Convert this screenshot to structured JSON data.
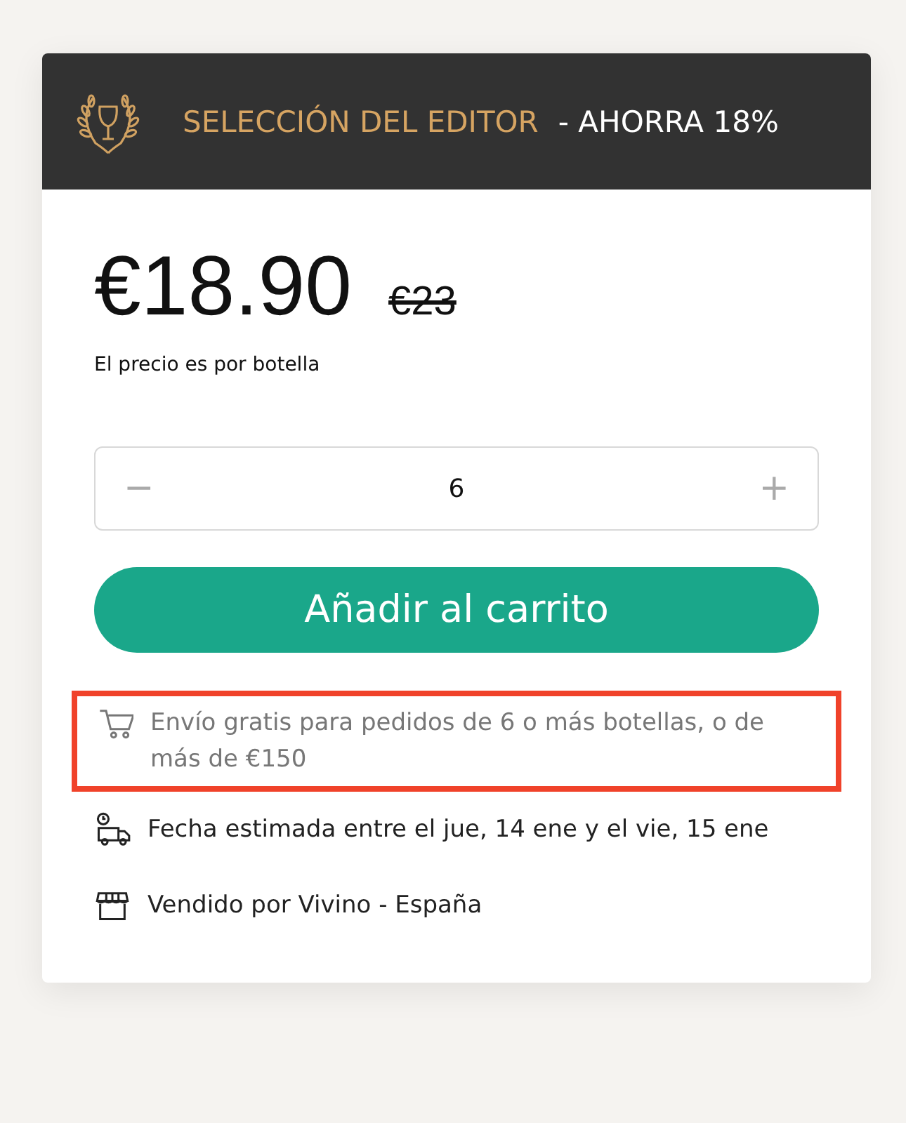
{
  "banner": {
    "label": "SELECCIÓN DEL EDITOR",
    "suffix": "- AHORRA 18%"
  },
  "price": {
    "current": "€18.90",
    "original": "€23",
    "note": "El precio es por botella"
  },
  "quantity": {
    "minus": "−",
    "value": "6",
    "plus": "+"
  },
  "add_button": "Añadir al carrito",
  "info": [
    {
      "kind": "cart",
      "text": "Envío gratis para pedidos de 6 o más botellas, o de más de €150",
      "muted": true,
      "highlighted": true
    },
    {
      "kind": "truck",
      "text": "Fecha estimada entre el jue, 14 ene y el vie, 15 ene",
      "muted": false,
      "highlighted": false
    },
    {
      "kind": "store",
      "text": "Vendido por Vivino - España",
      "muted": false,
      "highlighted": false
    }
  ]
}
